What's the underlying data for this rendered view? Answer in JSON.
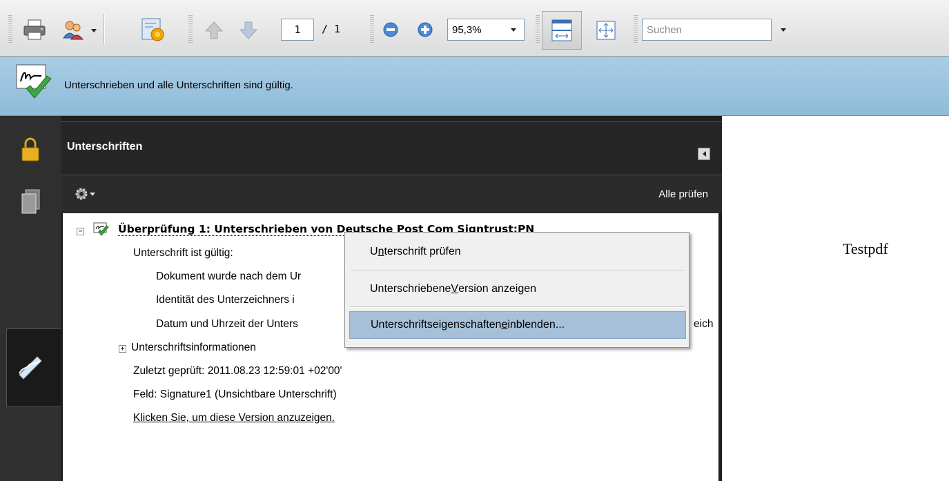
{
  "toolbar": {
    "page_current": "1",
    "page_total": "/ 1",
    "zoom": "95,3%",
    "search_placeholder": "Suchen"
  },
  "notification": {
    "text": "Unterschrieben und alle Unterschriften sind gültig."
  },
  "panel": {
    "title": "Unterschriften",
    "verify_all": "Alle prüfen",
    "tree": {
      "root": "Überprüfung 1: Unterschrieben von Deutsche Post Com Signtrust:PN",
      "valid": "Unterschrift ist gültig:",
      "doc_changed": "Dokument wurde nach dem Ur",
      "identity": "Identität des Unterzeichners i",
      "datetime": "Datum und Uhrzeit der Unters",
      "datetime_tail": "eich",
      "sig_info": "Unterschriftsinformationen",
      "last_checked": "Zuletzt geprüft: 2011.08.23 12:59:01 +02'00'",
      "field": "Feld: Signature1 (Unsichtbare Unterschrift)",
      "view_link": "Klicken Sie, um diese Version anzuzeigen."
    }
  },
  "context_menu": {
    "verify": {
      "pre": "U",
      "key": "n",
      "post": "terschrift prüfen"
    },
    "show_version": {
      "pre": "Unterschriebene ",
      "key": "V",
      "post": "ersion anzeigen"
    },
    "properties": {
      "pre": "Unterschriftseigenschaften ",
      "key": "e",
      "post": "inblenden..."
    }
  },
  "document": {
    "text": "Testpdf"
  },
  "colors": {
    "notify_bar": "#a9cde6",
    "panel_dark": "#262626",
    "menu_highlight": "#a5c0d8"
  }
}
